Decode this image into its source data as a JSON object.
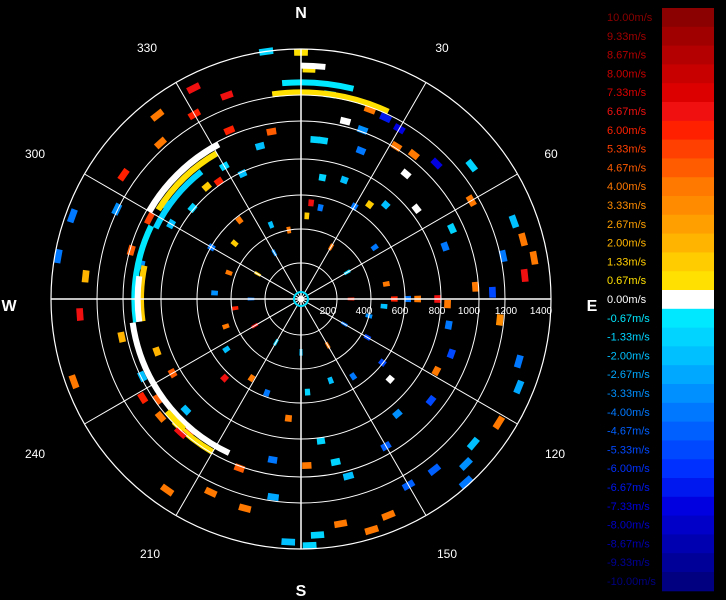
{
  "compass": {
    "north": "N",
    "east": "E",
    "south": "S",
    "west": "W"
  },
  "bearings": [
    "30",
    "60",
    "120",
    "150",
    "210",
    "240",
    "300",
    "330"
  ],
  "range_labels": [
    "200",
    "400",
    "600",
    "800",
    "1000",
    "1200",
    "1400"
  ],
  "legend": {
    "positive": [
      {
        "label": "10.00m/s",
        "color": "#8b0000"
      },
      {
        "label": "9.33m/s",
        "color": "#a00000"
      },
      {
        "label": "8.67m/s",
        "color": "#b40000"
      },
      {
        "label": "8.00m/s",
        "color": "#c80000"
      },
      {
        "label": "7.33m/s",
        "color": "#dc0000"
      },
      {
        "label": "6.67m/s",
        "color": "#f01010"
      },
      {
        "label": "6.00m/s",
        "color": "#ff2000"
      },
      {
        "label": "5.33m/s",
        "color": "#ff4000"
      },
      {
        "label": "4.67m/s",
        "color": "#ff5c00"
      },
      {
        "label": "4.00m/s",
        "color": "#ff7800"
      },
      {
        "label": "3.33m/s",
        "color": "#ff8c00"
      },
      {
        "label": "2.67m/s",
        "color": "#ffa000"
      },
      {
        "label": "2.00m/s",
        "color": "#ffb400"
      },
      {
        "label": "1.33m/s",
        "color": "#ffcc00"
      },
      {
        "label": "0.67m/s",
        "color": "#ffe000"
      }
    ],
    "zero": {
      "label": "0.00m/s",
      "color": "#ffffff"
    },
    "negative": [
      {
        "label": "-0.67m/s",
        "color": "#00e8ff"
      },
      {
        "label": "-1.33m/s",
        "color": "#00d4ff"
      },
      {
        "label": "-2.00m/s",
        "color": "#00c0ff"
      },
      {
        "label": "-2.67m/s",
        "color": "#00a8ff"
      },
      {
        "label": "-3.33m/s",
        "color": "#0090ff"
      },
      {
        "label": "-4.00m/s",
        "color": "#0078ff"
      },
      {
        "label": "-4.67m/s",
        "color": "#0060ff"
      },
      {
        "label": "-5.33m/s",
        "color": "#0048ff"
      },
      {
        "label": "-6.00m/s",
        "color": "#0030ff"
      },
      {
        "label": "-6.67m/s",
        "color": "#0018f0"
      },
      {
        "label": "-7.33m/s",
        "color": "#0000e0"
      },
      {
        "label": "-8.00m/s",
        "color": "#0000c8"
      },
      {
        "label": "-8.67m/s",
        "color": "#0000b0"
      },
      {
        "label": "-9.33m/s",
        "color": "#000098"
      },
      {
        "label": "-10.00m/s",
        "color": "#000080"
      }
    ]
  },
  "velocity_bins": [
    {
      "bearing": 0,
      "range": 1480,
      "value": 1.0
    },
    {
      "bearing": 2,
      "range": 1380,
      "value": 1.0
    },
    {
      "bearing": 8,
      "range": 1240,
      "value": -1.3
    },
    {
      "bearing": 20,
      "range": 1210,
      "value": 4.0
    },
    {
      "bearing": 25,
      "range": 1200,
      "value": -6.7
    },
    {
      "bearing": 30,
      "range": 1180,
      "value": -7.3
    },
    {
      "bearing": 14,
      "range": 1100,
      "value": 0.0
    },
    {
      "bearing": 20,
      "range": 1080,
      "value": -3.3
    },
    {
      "bearing": 32,
      "range": 1080,
      "value": 4.0
    },
    {
      "bearing": 38,
      "range": 1100,
      "value": 4.0
    },
    {
      "bearing": 45,
      "range": 1150,
      "value": -7.3
    },
    {
      "bearing": 52,
      "range": 1300,
      "value": -1.3
    },
    {
      "bearing": 5,
      "range": 960,
      "value": -1.3
    },
    {
      "bearing": 8,
      "range": 960,
      "value": -1.3
    },
    {
      "bearing": 22,
      "range": 960,
      "value": -4.0
    },
    {
      "bearing": 40,
      "range": 980,
      "value": 0.0
    },
    {
      "bearing": 60,
      "range": 1180,
      "value": 4.0
    },
    {
      "bearing": 70,
      "range": 1360,
      "value": -2.0
    },
    {
      "bearing": 75,
      "range": 1380,
      "value": 4.0
    },
    {
      "bearing": 80,
      "range": 1420,
      "value": 4.0
    },
    {
      "bearing": 84,
      "range": 1350,
      "value": 6.7
    },
    {
      "bearing": 78,
      "range": 1240,
      "value": -4.0
    },
    {
      "bearing": 88,
      "range": 1150,
      "value": -5.3
    },
    {
      "bearing": 96,
      "range": 1200,
      "value": 3.3
    },
    {
      "bearing": 106,
      "range": 1360,
      "value": -4.0
    },
    {
      "bearing": 112,
      "range": 1410,
      "value": -2.7
    },
    {
      "bearing": 122,
      "range": 1400,
      "value": 4.0
    },
    {
      "bearing": 130,
      "range": 1350,
      "value": -2.0
    },
    {
      "bearing": 135,
      "range": 1400,
      "value": -3.3
    },
    {
      "bearing": 138,
      "range": 1480,
      "value": -4.0
    },
    {
      "bearing": 142,
      "range": 1300,
      "value": -4.7
    },
    {
      "bearing": 150,
      "range": 1290,
      "value": -4.7
    },
    {
      "bearing": 158,
      "range": 1400,
      "value": 4.0
    },
    {
      "bearing": 163,
      "range": 1450,
      "value": 4.0
    },
    {
      "bearing": 170,
      "range": 1370,
      "value": 4.0
    },
    {
      "bearing": 176,
      "range": 1420,
      "value": -1.3
    },
    {
      "bearing": 178,
      "range": 1480,
      "value": -1.3
    },
    {
      "bearing": 183,
      "range": 1460,
      "value": -2.0
    },
    {
      "bearing": 188,
      "range": 1200,
      "value": -2.7
    },
    {
      "bearing": 195,
      "range": 1300,
      "value": 4.0
    },
    {
      "bearing": 205,
      "range": 1280,
      "value": 4.0
    },
    {
      "bearing": 215,
      "range": 1400,
      "value": 4.0
    },
    {
      "bearing": 230,
      "range": 1100,
      "value": 4.0
    },
    {
      "bearing": 235,
      "range": 1050,
      "value": 4.7
    },
    {
      "bearing": 238,
      "range": 1120,
      "value": 6.0
    },
    {
      "bearing": 244,
      "range": 1060,
      "value": -2.0
    },
    {
      "bearing": 250,
      "range": 1450,
      "value": 4.0
    },
    {
      "bearing": 258,
      "range": 1100,
      "value": 2.0
    },
    {
      "bearing": 266,
      "range": 1330,
      "value": 6.7
    },
    {
      "bearing": 276,
      "range": 1300,
      "value": 2.0
    },
    {
      "bearing": 280,
      "range": 1480,
      "value": -4.0
    },
    {
      "bearing": 290,
      "range": 1460,
      "value": -4.0
    },
    {
      "bearing": 296,
      "range": 1230,
      "value": -3.3
    },
    {
      "bearing": 305,
      "range": 1300,
      "value": 6.0
    },
    {
      "bearing": 318,
      "range": 1260,
      "value": 4.0
    },
    {
      "bearing": 322,
      "range": 1400,
      "value": 4.0
    },
    {
      "bearing": 330,
      "range": 1280,
      "value": 6.0
    },
    {
      "bearing": 333,
      "range": 1420,
      "value": 6.7
    },
    {
      "bearing": 340,
      "range": 1300,
      "value": 6.7
    },
    {
      "bearing": 352,
      "range": 1500,
      "value": -1.3
    },
    {
      "bearing": 337,
      "range": 1100,
      "value": 6.0
    },
    {
      "bearing": 345,
      "range": 950,
      "value": -2.0
    },
    {
      "bearing": 350,
      "range": 1020,
      "value": 4.7
    },
    {
      "bearing": 305,
      "range": 980,
      "value": -1.3
    },
    {
      "bearing": 300,
      "range": 900,
      "value": -2.0
    },
    {
      "bearing": 310,
      "range": 850,
      "value": -1.3
    },
    {
      "bearing": 320,
      "range": 880,
      "value": 1.3
    },
    {
      "bearing": 325,
      "range": 860,
      "value": 6.0
    },
    {
      "bearing": 330,
      "range": 920,
      "value": -1.3
    },
    {
      "bearing": 335,
      "range": 830,
      "value": -2.0
    },
    {
      "bearing": 282,
      "range": 980,
      "value": -3.3
    },
    {
      "bearing": 286,
      "range": 1060,
      "value": 4.7
    },
    {
      "bearing": 250,
      "range": 920,
      "value": 2.0
    },
    {
      "bearing": 240,
      "range": 890,
      "value": 4.7
    },
    {
      "bearing": 226,
      "range": 960,
      "value": -2.0
    },
    {
      "bearing": 220,
      "range": 1040,
      "value": 6.7
    },
    {
      "bearing": 200,
      "range": 1080,
      "value": 4.7
    },
    {
      "bearing": 190,
      "range": 980,
      "value": -4.0
    },
    {
      "bearing": 178,
      "range": 1000,
      "value": 4.0
    },
    {
      "bearing": 172,
      "range": 860,
      "value": -1.3
    },
    {
      "bearing": 168,
      "range": 1000,
      "value": -1.3
    },
    {
      "bearing": 165,
      "range": 1100,
      "value": -2.0
    },
    {
      "bearing": 150,
      "range": 1020,
      "value": -4.7
    },
    {
      "bearing": 140,
      "range": 900,
      "value": -3.3
    },
    {
      "bearing": 128,
      "range": 990,
      "value": -5.3
    },
    {
      "bearing": 118,
      "range": 920,
      "value": 4.0
    },
    {
      "bearing": 110,
      "range": 960,
      "value": -5.3
    },
    {
      "bearing": 100,
      "range": 900,
      "value": -4.0
    },
    {
      "bearing": 92,
      "range": 880,
      "value": 4.0
    },
    {
      "bearing": 86,
      "range": 1050,
      "value": 4.0
    },
    {
      "bearing": 70,
      "range": 920,
      "value": -4.0
    },
    {
      "bearing": 65,
      "range": 1000,
      "value": -1.3
    },
    {
      "bearing": 52,
      "range": 880,
      "value": 0.0
    },
    {
      "bearing": 42,
      "range": 760,
      "value": -2.0
    },
    {
      "bearing": 36,
      "range": 700,
      "value": 1.3
    },
    {
      "bearing": 30,
      "range": 640,
      "value": -4.0
    },
    {
      "bearing": 20,
      "range": 760,
      "value": -2.0
    },
    {
      "bearing": 10,
      "range": 740,
      "value": -1.3
    },
    {
      "bearing": 6,
      "range": 580,
      "value": 6.7
    },
    {
      "bearing": 12,
      "range": 560,
      "value": -4.0
    },
    {
      "bearing": 4,
      "range": 500,
      "value": 1.3
    },
    {
      "bearing": 55,
      "range": 540,
      "value": -4.0
    },
    {
      "bearing": 80,
      "range": 520,
      "value": 4.0
    },
    {
      "bearing": 95,
      "range": 500,
      "value": -2.0
    },
    {
      "bearing": 104,
      "range": 420,
      "value": -3.3
    },
    {
      "bearing": 120,
      "range": 460,
      "value": -5.3
    },
    {
      "bearing": 128,
      "range": 620,
      "value": -5.3
    },
    {
      "bearing": 132,
      "range": 720,
      "value": 0.0
    },
    {
      "bearing": 146,
      "range": 560,
      "value": -4.0
    },
    {
      "bearing": 160,
      "range": 520,
      "value": -2.0
    },
    {
      "bearing": 176,
      "range": 560,
      "value": -1.3
    },
    {
      "bearing": 186,
      "range": 720,
      "value": 4.0
    },
    {
      "bearing": 200,
      "range": 600,
      "value": -4.0
    },
    {
      "bearing": 212,
      "range": 560,
      "value": 4.0
    },
    {
      "bearing": 224,
      "range": 660,
      "value": 6.7
    },
    {
      "bearing": 236,
      "range": 540,
      "value": -2.0
    },
    {
      "bearing": 250,
      "range": 480,
      "value": 4.0
    },
    {
      "bearing": 262,
      "range": 400,
      "value": 6.0
    },
    {
      "bearing": 274,
      "range": 520,
      "value": -3.3
    },
    {
      "bearing": 290,
      "range": 460,
      "value": 4.0
    },
    {
      "bearing": 300,
      "range": 620,
      "value": -4.0
    },
    {
      "bearing": 310,
      "range": 520,
      "value": 1.3
    },
    {
      "bearing": 322,
      "range": 600,
      "value": 4.0
    },
    {
      "bearing": 338,
      "range": 480,
      "value": -2.0
    },
    {
      "bearing": 350,
      "range": 420,
      "value": 4.0
    },
    {
      "bearing": 30,
      "range": 360,
      "value": 4.0
    },
    {
      "bearing": 60,
      "range": 320,
      "value": -1.3
    },
    {
      "bearing": 90,
      "range": 300,
      "value": 6.0
    },
    {
      "bearing": 120,
      "range": 300,
      "value": -4.0
    },
    {
      "bearing": 150,
      "range": 320,
      "value": 4.0
    },
    {
      "bearing": 180,
      "range": 320,
      "value": -2.0
    },
    {
      "bearing": 210,
      "range": 300,
      "value": -1.3
    },
    {
      "bearing": 240,
      "range": 320,
      "value": 6.7
    },
    {
      "bearing": 270,
      "range": 300,
      "value": -4.0
    },
    {
      "bearing": 300,
      "range": 300,
      "value": 1.3
    },
    {
      "bearing": 330,
      "range": 320,
      "value": -3.3
    },
    {
      "bearing": 90,
      "range": 820,
      "value": 6.7
    },
    {
      "bearing": 90,
      "range": 700,
      "value": 4.0
    },
    {
      "bearing": 90,
      "range": 560,
      "value": 6.0
    },
    {
      "bearing": 90,
      "range": 640,
      "value": -4.0
    }
  ],
  "arcs": [
    {
      "r": 1240,
      "from": 352,
      "to": 25,
      "value": 1.0
    },
    {
      "r": 1300,
      "from": 355,
      "to": 14,
      "value": -1.0
    },
    {
      "r": 1400,
      "from": 0,
      "to": 6,
      "value": 0.0
    },
    {
      "r": 1050,
      "from": 300,
      "to": 332,
      "value": 0.0
    },
    {
      "r": 1010,
      "from": 302,
      "to": 330,
      "value": 1.0
    },
    {
      "r": 970,
      "from": 296,
      "to": 322,
      "value": -1.3
    },
    {
      "r": 1030,
      "from": 296,
      "to": 300,
      "value": 5.3
    },
    {
      "r": 1000,
      "from": 262,
      "to": 296,
      "value": -0.7
    },
    {
      "r": 960,
      "from": 262,
      "to": 282,
      "value": 1.3
    },
    {
      "r": 980,
      "from": 262,
      "to": 278,
      "value": 0.0
    },
    {
      "r": 1020,
      "from": 205,
      "to": 262,
      "value": 0.0
    },
    {
      "r": 1060,
      "from": 210,
      "to": 226,
      "value": 1.0
    },
    {
      "r": 1080,
      "from": 220,
      "to": 224,
      "value": 6.7
    },
    {
      "r": 1050,
      "from": 222,
      "to": 230,
      "value": 1.0
    }
  ]
}
